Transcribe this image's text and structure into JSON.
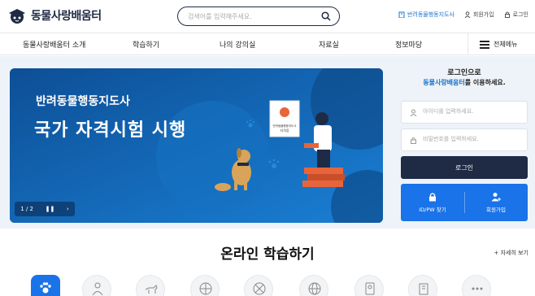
{
  "header": {
    "logo_text": "동물사랑배움터",
    "search_placeholder": "검색어를 입력해주세요.",
    "links": [
      {
        "label": "반려동물행동지도사",
        "icon": "building-icon"
      },
      {
        "label": "회원가입",
        "icon": "user-icon"
      },
      {
        "label": "로그인",
        "icon": "lock-icon"
      }
    ]
  },
  "nav": {
    "items": [
      "동물사랑배움터 소개",
      "학습하기",
      "나의 강의실",
      "자료실",
      "정보마당"
    ],
    "all_menu": "전체메뉴"
  },
  "banner": {
    "title1": "반려동물행동지도사",
    "title2": "국가 자격시험 시행",
    "certificate_label": "반려동물행동지도사 자격증",
    "pager": "1 / 2"
  },
  "login": {
    "title": "로그인으로",
    "subtitle_brand": "동물사랑배움터",
    "subtitle_rest": "를 이용하세요.",
    "id_placeholder": "아이디를 입력하세요.",
    "pw_placeholder": "비밀번호를 입력하세요.",
    "button": "로그인",
    "find_label": "ID/PW 찾기",
    "join_label": "회원가입"
  },
  "learning": {
    "title": "온라인 학습하기",
    "more": "자세히 보기",
    "categories": [
      {
        "icon": "paw-icon",
        "active": true
      },
      {
        "icon": "person-icon",
        "active": false
      },
      {
        "icon": "dog-icon",
        "active": false
      },
      {
        "icon": "wheel-icon",
        "active": false
      },
      {
        "icon": "wheel-icon",
        "active": false
      },
      {
        "icon": "globe-icon",
        "active": false
      },
      {
        "icon": "badge-icon",
        "active": false
      },
      {
        "icon": "building-icon",
        "active": false
      },
      {
        "icon": "more-icon",
        "active": false
      }
    ]
  },
  "colors": {
    "navy": "#1f2a44",
    "accent": "#1a73e8",
    "banner_bg": "#0f5aa3",
    "band_bg": "#eef3f9"
  }
}
